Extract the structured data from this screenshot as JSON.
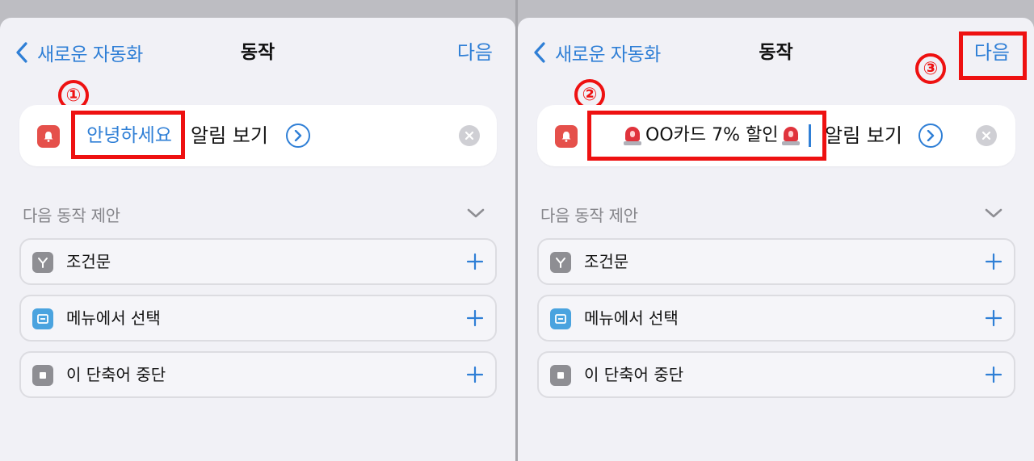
{
  "colors": {
    "accent": "#2f7fd6",
    "highlight": "#ee1111",
    "app_icon": "#e5504b"
  },
  "left": {
    "nav": {
      "back_label": "새로운 자동화",
      "title": "동작",
      "next_label": "다음"
    },
    "action": {
      "token_text": "안녕하세요",
      "trailing_text": "알림 보기"
    },
    "step_marker": "①"
  },
  "right": {
    "nav": {
      "back_label": "새로운 자동화",
      "title": "동작",
      "next_label": "다음"
    },
    "action": {
      "token_text": "OO카드 7% 할인",
      "trailing_text": "알림 보기"
    },
    "step_marker_input": "②",
    "step_marker_next": "③"
  },
  "suggestions": {
    "header": "다음 동작 제안",
    "items": [
      {
        "label": "조건문",
        "icon": "branch-icon",
        "icon_color": "#8e8e93"
      },
      {
        "label": "메뉴에서 선택",
        "icon": "menu-icon",
        "icon_color": "#4aa3df"
      },
      {
        "label": "이 단축어 중단",
        "icon": "stop-icon",
        "icon_color": "#8e8e93"
      }
    ]
  }
}
